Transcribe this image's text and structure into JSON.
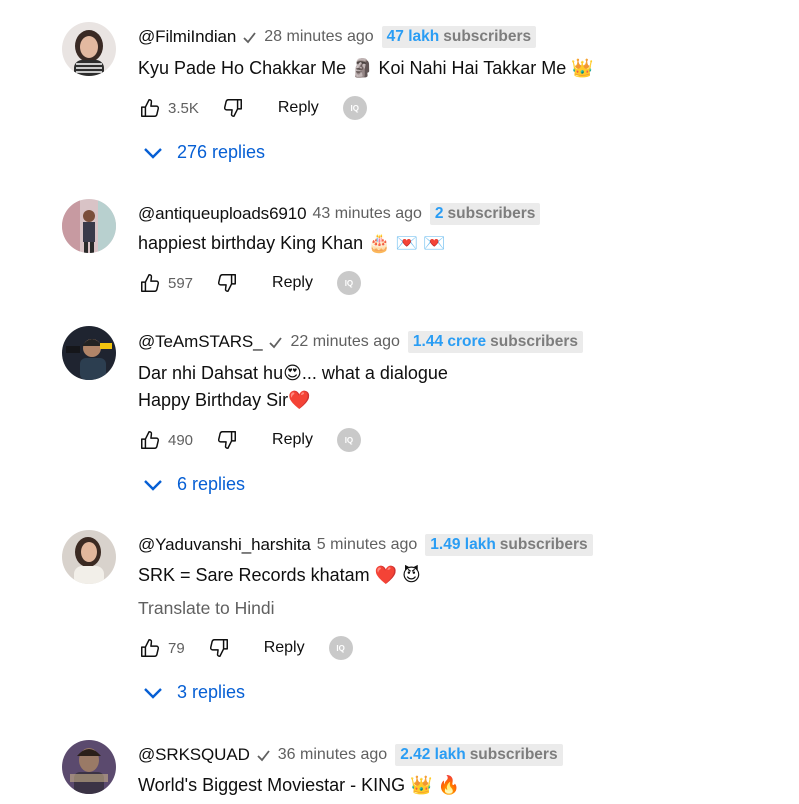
{
  "comments": [
    {
      "author": "@FilmiIndian",
      "verified": true,
      "time": "28 minutes ago",
      "subs_count": "47 lakh",
      "subs_label": "subscribers",
      "text_lines": [
        "Kyu Pade Ho Chakkar Me 🗿 Koi Nahi Hai Takkar Me 👑"
      ],
      "likes": "3.5K",
      "reply_label": "Reply",
      "replies": "276 replies"
    },
    {
      "author": "@antiqueuploads6910",
      "verified": false,
      "time": "43 minutes ago",
      "subs_count": "2",
      "subs_label": "subscribers",
      "text_lines": [
        "happiest birthday King Khan 🎂 💌 💌"
      ],
      "likes": "597",
      "reply_label": "Reply"
    },
    {
      "author": "@TeAmSTARS_",
      "verified": true,
      "time": "22 minutes ago",
      "subs_count": "1.44 crore",
      "subs_label": "subscribers",
      "text_lines": [
        "Dar nhi Dahsat hu😍... what a dialogue",
        "Happy Birthday Sir❤️"
      ],
      "likes": "490",
      "reply_label": "Reply",
      "replies": "6 replies"
    },
    {
      "author": "@Yaduvanshi_harshita",
      "verified": false,
      "time": "5 minutes ago",
      "subs_count": "1.49 lakh",
      "subs_label": "subscribers",
      "text_lines": [
        "SRK = Sare Records khatam ❤️ 😈"
      ],
      "translate": "Translate to Hindi",
      "likes": "79",
      "reply_label": "Reply",
      "replies": "3 replies"
    },
    {
      "author": "@SRKSQUAD",
      "verified": true,
      "time": "36 minutes ago",
      "subs_count": "2.42 lakh",
      "subs_label": "subscribers",
      "text_lines": [
        "World's Biggest Moviestar - KING 👑 🔥"
      ]
    }
  ],
  "iq_badge": "IQ",
  "colors": {
    "link": "#065fd4",
    "subs_num": "#2a9df4",
    "secondary": "#606060"
  }
}
